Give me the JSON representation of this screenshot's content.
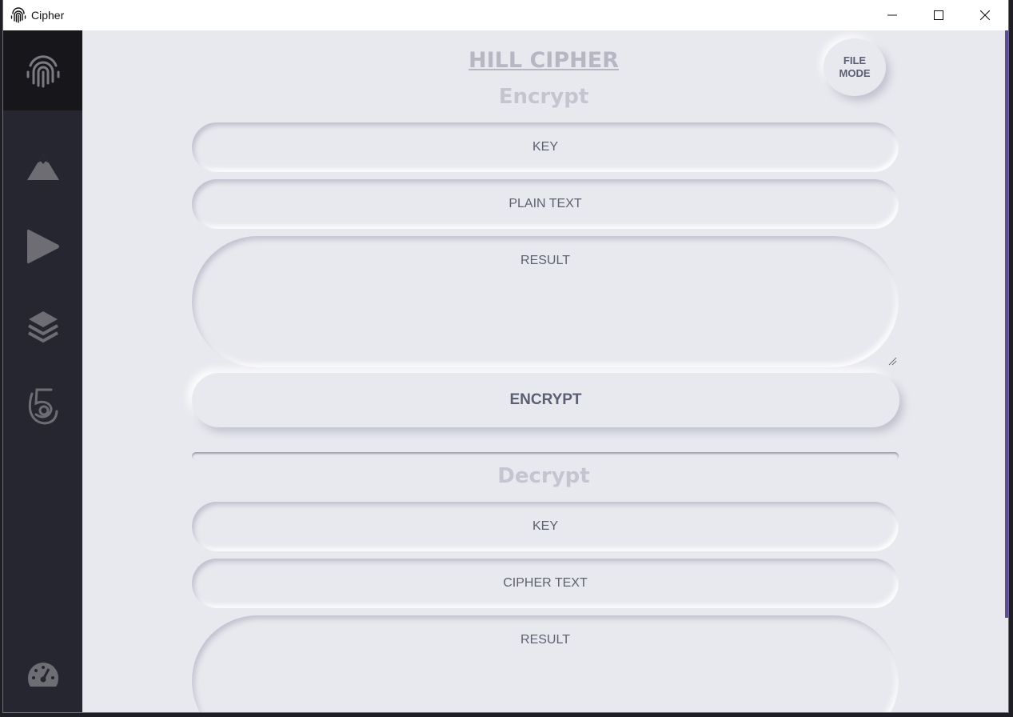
{
  "window": {
    "title": "Cipher"
  },
  "sidebar": {
    "brand_icon": "fingerprint-icon",
    "items": [
      {
        "icon": "mountain-icon"
      },
      {
        "icon": "play-icon"
      },
      {
        "icon": "layers-icon"
      },
      {
        "icon": "html5-icon"
      }
    ],
    "footer_icon": "speedometer-icon"
  },
  "page": {
    "title": "HILL CIPHER",
    "file_mode_line1": "FILE",
    "file_mode_line2": "MODE"
  },
  "encrypt": {
    "heading": "Encrypt",
    "key_placeholder": "KEY",
    "text_placeholder": "PLAIN TEXT",
    "result_placeholder": "RESULT",
    "button_label": "ENCRYPT"
  },
  "decrypt": {
    "heading": "Decrypt",
    "key_placeholder": "KEY",
    "text_placeholder": "CIPHER TEXT",
    "result_placeholder": "RESULT"
  },
  "colors": {
    "sidebar": "#262631",
    "sidebar_brand": "#16161b",
    "background": "#e8e9ee",
    "accent": "#5c4d9a"
  }
}
